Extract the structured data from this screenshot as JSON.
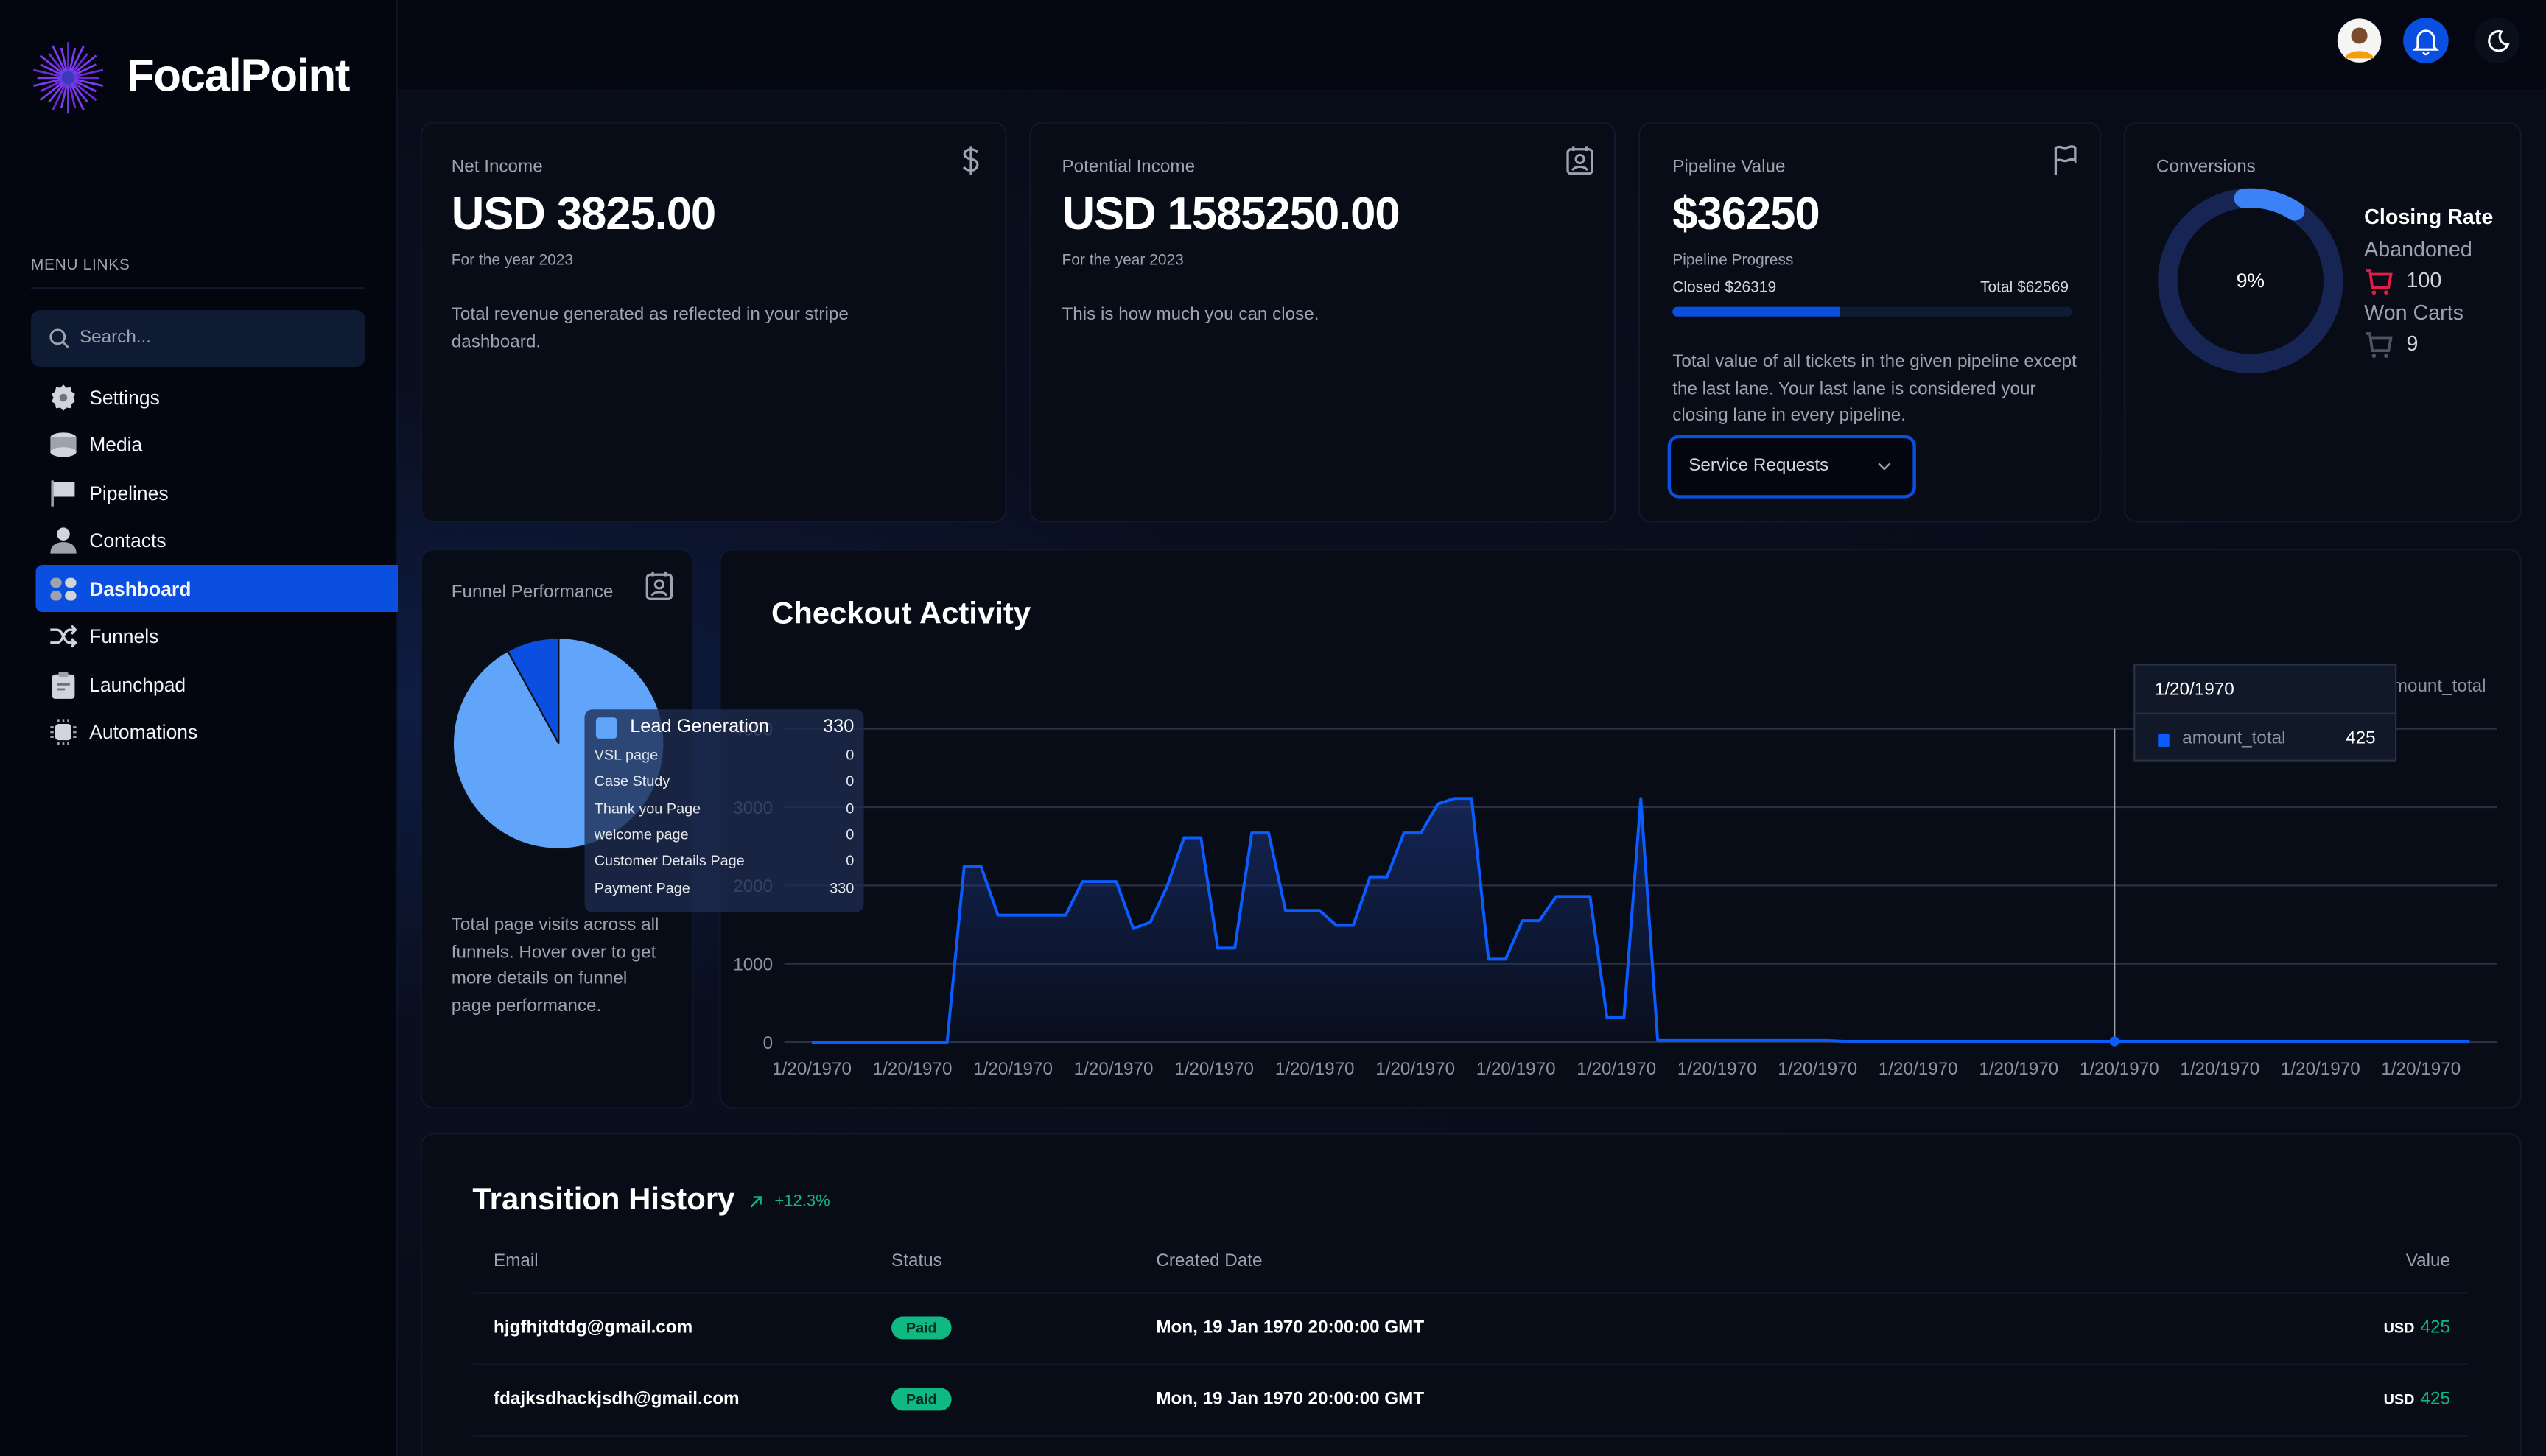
{
  "brand": {
    "name": "FocalPoint"
  },
  "sidebar": {
    "section_label": "MENU LINKS",
    "search_placeholder": "Search...",
    "items": [
      {
        "label": "Settings",
        "icon": "gear-icon"
      },
      {
        "label": "Media",
        "icon": "database-icon"
      },
      {
        "label": "Pipelines",
        "icon": "flag-icon"
      },
      {
        "label": "Contacts",
        "icon": "user-icon"
      },
      {
        "label": "Dashboard",
        "icon": "dashboard-icon",
        "active": true
      },
      {
        "label": "Funnels",
        "icon": "shuffle-icon"
      },
      {
        "label": "Launchpad",
        "icon": "clipboard-icon"
      },
      {
        "label": "Automations",
        "icon": "chip-icon"
      }
    ]
  },
  "header": {
    "icons": [
      "avatar",
      "bell-icon",
      "moon-icon"
    ],
    "accent": "#0b4fe0"
  },
  "cards": {
    "net_income": {
      "label": "Net Income",
      "value": "USD 3825.00",
      "sub": "For the year 2023",
      "desc": "Total revenue generated as reflected in your stripe dashboard.",
      "icon": "dollar-icon"
    },
    "potential_income": {
      "label": "Potential Income",
      "value": "USD 1585250.00",
      "sub": "For the year 2023",
      "desc": "This is how much you can close.",
      "icon": "contact-card-icon"
    },
    "pipeline_value": {
      "label": "Pipeline Value",
      "value": "$36250",
      "progress_label": "Pipeline Progress",
      "closed": "Closed $26319",
      "total": "Total $62569",
      "progress_fraction": 0.42,
      "desc": "Total value of all tickets in the given pipeline except the last lane. Your last lane is considered your closing lane in every pipeline.",
      "select_value": "Service Requests",
      "icon": "flag-icon"
    },
    "conversions": {
      "label": "Conversions",
      "percent_label": "9%",
      "percent": 9,
      "closing_rate_label": "Closing Rate",
      "abandoned_label": "Abandoned",
      "abandoned_value": "100",
      "won_label": "Won Carts",
      "won_value": "9",
      "colors": {
        "arc": "#3b82f6",
        "track": "#172554",
        "abandoned": "#e11d48"
      }
    }
  },
  "funnel": {
    "title": "Funnel Performance",
    "desc": "Total page visits across all funnels. Hover over to get more details on funnel page performance.",
    "pie_shares": [
      0.92,
      0.08
    ],
    "pie_colors": [
      "#60a5fa",
      "#0b4fe0"
    ],
    "tooltip": {
      "name": "Lead Generation",
      "value": "330",
      "rows": [
        {
          "label": "VSL page",
          "value": "0"
        },
        {
          "label": "Case Study",
          "value": "0"
        },
        {
          "label": "Thank you Page",
          "value": "0"
        },
        {
          "label": "welcome page",
          "value": "0"
        },
        {
          "label": "Customer Details Page",
          "value": "0"
        },
        {
          "label": "Payment Page",
          "value": "330"
        }
      ]
    }
  },
  "chart_data": {
    "type": "area",
    "title": "Checkout Activity",
    "series": [
      {
        "name": "amount_total",
        "color": "#0b5cff",
        "values": [
          0,
          0,
          0,
          0,
          0,
          0,
          0,
          0,
          0,
          2240,
          2240,
          1620,
          1620,
          1620,
          1620,
          1620,
          2050,
          2050,
          2050,
          1450,
          1530,
          1990,
          2610,
          2610,
          1200,
          1200,
          2670,
          2670,
          1680,
          1680,
          1680,
          1490,
          1490,
          2110,
          2110,
          2670,
          2670,
          3040,
          3110,
          3110,
          1060,
          1060,
          1550,
          1550,
          1860,
          1860,
          1860,
          310,
          310,
          3110,
          20,
          20,
          20,
          20,
          20,
          20,
          20,
          20,
          20,
          20,
          20,
          10,
          10,
          10,
          10,
          10,
          10,
          10,
          10,
          10,
          10,
          10,
          10,
          10,
          10,
          10,
          10,
          10,
          10,
          10,
          10,
          10,
          10,
          10,
          10,
          10,
          10,
          10,
          10,
          10,
          10,
          10,
          10,
          10,
          10,
          10,
          10,
          10,
          10
        ]
      }
    ],
    "x_tick_labels": [
      "1/20/1970",
      "1/20/1970",
      "1/20/1970",
      "1/20/1970",
      "1/20/1970",
      "1/20/1970",
      "1/20/1970",
      "1/20/1970",
      "1/20/1970",
      "1/20/1970",
      "1/20/1970",
      "1/20/1970",
      "1/20/1970",
      "1/20/1970",
      "1/20/1970",
      "1/20/1970",
      "1/20/1970"
    ],
    "y_ticks": [
      0,
      1000,
      2000,
      3000,
      4000
    ],
    "ylim": [
      0,
      4000
    ],
    "grid": true,
    "legend": "top-right",
    "tooltip": {
      "date": "1/20/1970",
      "series": "amount_total",
      "value": "425"
    }
  },
  "transitions": {
    "title": "Transition History",
    "change": "+12.3%",
    "columns": [
      "Email",
      "Status",
      "Created Date",
      "Value"
    ],
    "rows": [
      {
        "email": "hjgfhjtdtdg@gmail.com",
        "status": "Paid",
        "date": "Mon, 19 Jan 1970 20:00:00 GMT",
        "currency": "USD",
        "value": "425"
      },
      {
        "email": "fdajksdhackjsdh@gmail.com",
        "status": "Paid",
        "date": "Mon, 19 Jan 1970 20:00:00 GMT",
        "currency": "USD",
        "value": "425"
      }
    ]
  }
}
